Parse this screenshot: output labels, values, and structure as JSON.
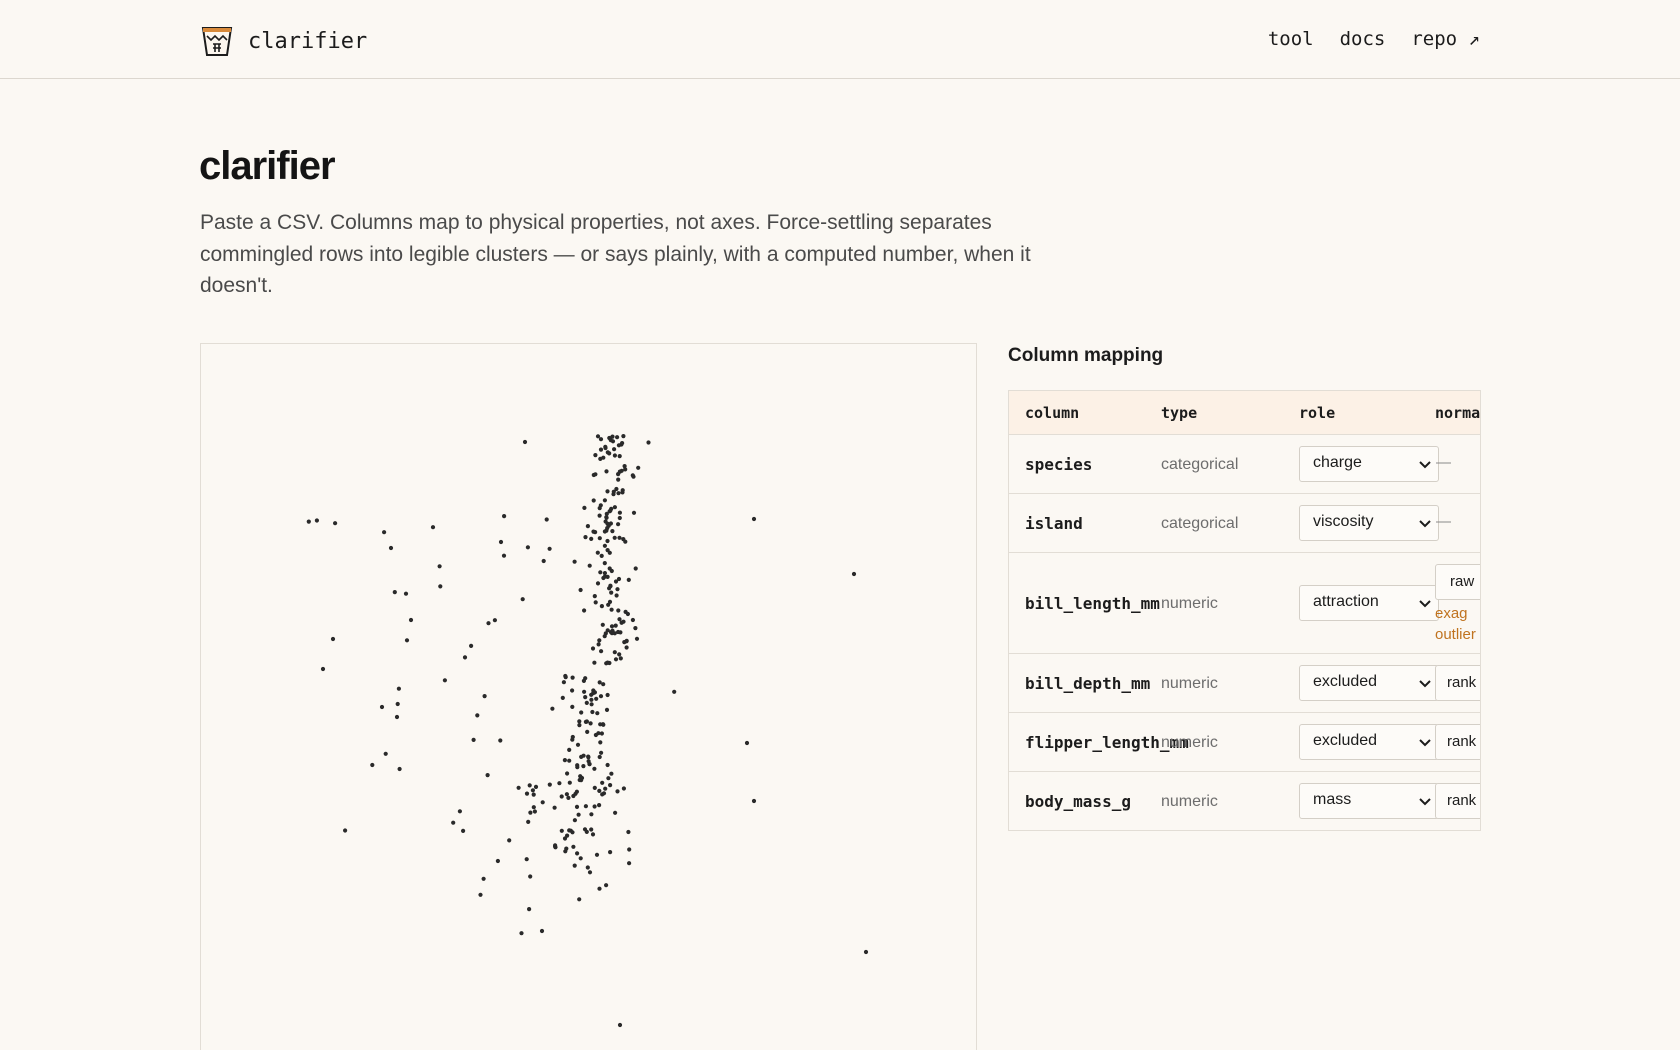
{
  "brand": {
    "name": "clarifier",
    "logo_icon": "bucket-logo-icon"
  },
  "nav": [
    {
      "label": "tool"
    },
    {
      "label": "docs"
    },
    {
      "label": "repo ↗"
    }
  ],
  "page": {
    "title": "clarifier",
    "lede": "Paste a CSV. Columns map to physical properties, not axes. Force-settling separates commingled rows into legible clusters — or says plainly, with a computed number, when it doesn't."
  },
  "mapping": {
    "title": "Column mapping",
    "headers": {
      "column": "column",
      "type": "type",
      "role": "role",
      "normalization": "norma"
    },
    "rows": [
      {
        "column": "species",
        "type": "categorical",
        "role": "charge",
        "norm": "—"
      },
      {
        "column": "island",
        "type": "categorical",
        "role": "viscosity",
        "norm": "—"
      },
      {
        "column": "bill_length_mm",
        "type": "numeric",
        "role": "attraction",
        "norm": "raw",
        "warning_line1": "exag",
        "warning_line2": "outlier"
      },
      {
        "column": "bill_depth_mm",
        "type": "numeric",
        "role": "excluded",
        "norm": "rank"
      },
      {
        "column": "flipper_length_mm",
        "type": "numeric",
        "role": "excluded",
        "norm": "rank"
      },
      {
        "column": "body_mass_g",
        "type": "numeric",
        "role": "mass",
        "norm": "rank"
      }
    ]
  },
  "colors": {
    "background": "#fbf8f3",
    "dot": "#2a2a2a",
    "header_bg": "#fcf1e6",
    "warning": "#c0731f"
  }
}
